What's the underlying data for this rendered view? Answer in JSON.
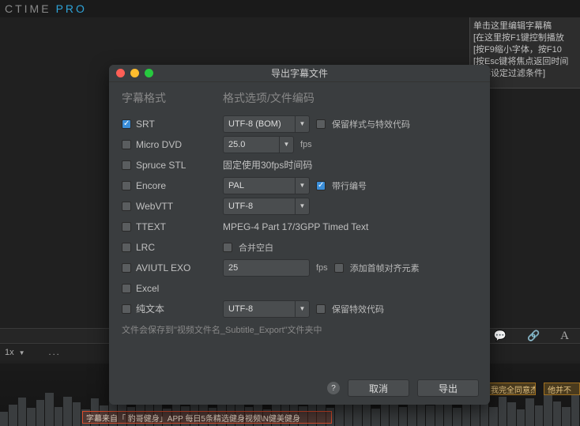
{
  "brand": {
    "part1": "CTIME",
    "part2": "PRO"
  },
  "notes": {
    "l1": "单击这里编辑字幕稿",
    "l2": "[在这里按F1键控制播放",
    "l3": "[按F9缩小字体，按F10",
    "l4": "[按Esc键将焦点返回时间",
    "l5": "底部设定过滤条件]"
  },
  "modal": {
    "title": "导出字幕文件",
    "section_left": "字幕格式",
    "section_right": "格式选项/文件编码",
    "formats": {
      "srt": "SRT",
      "microdvd": "Micro DVD",
      "sprucestl": "Spruce STL",
      "encore": "Encore",
      "webvtt": "WebVTT",
      "ttext": "TTEXT",
      "lrc": "LRC",
      "aviutl": "AVIUTL EXO",
      "excel": "Excel",
      "plaintext": "纯文本"
    },
    "opts": {
      "srt_enc": "UTF-8 (BOM)",
      "srt_keep": "保留样式与特效代码",
      "microdvd_fps_val": "25.0",
      "fps_unit": "fps",
      "spruce_note": "固定使用30fps时间码",
      "encore_std": "PAL",
      "encore_linenum": "带行编号",
      "webvtt_enc": "UTF-8",
      "ttext_note": "MPEG-4 Part 17/3GPP Timed Text",
      "lrc_merge": "合并空白",
      "aviutl_fps_val": "25",
      "aviutl_align": "添加首帧对齐元素",
      "plain_enc": "UTF-8",
      "plain_keep": "保留特效代码"
    },
    "save_note": "文件会保存到\"视频文件名_Subtitle_Export\"文件夹中",
    "btn_cancel": "取消",
    "btn_export": "导出"
  },
  "toolbar": {
    "speech": "💬",
    "link": "🔗",
    "letter": "A"
  },
  "zoom": {
    "level": "1x",
    "drop": "▼",
    "dots": "..."
  },
  "subs": {
    "y1": "我完全同意杰",
    "y2": "他并不",
    "hl": "字幕来自「 豹哥健身」APP  每日5条精选健身视频\\N健美健身"
  }
}
